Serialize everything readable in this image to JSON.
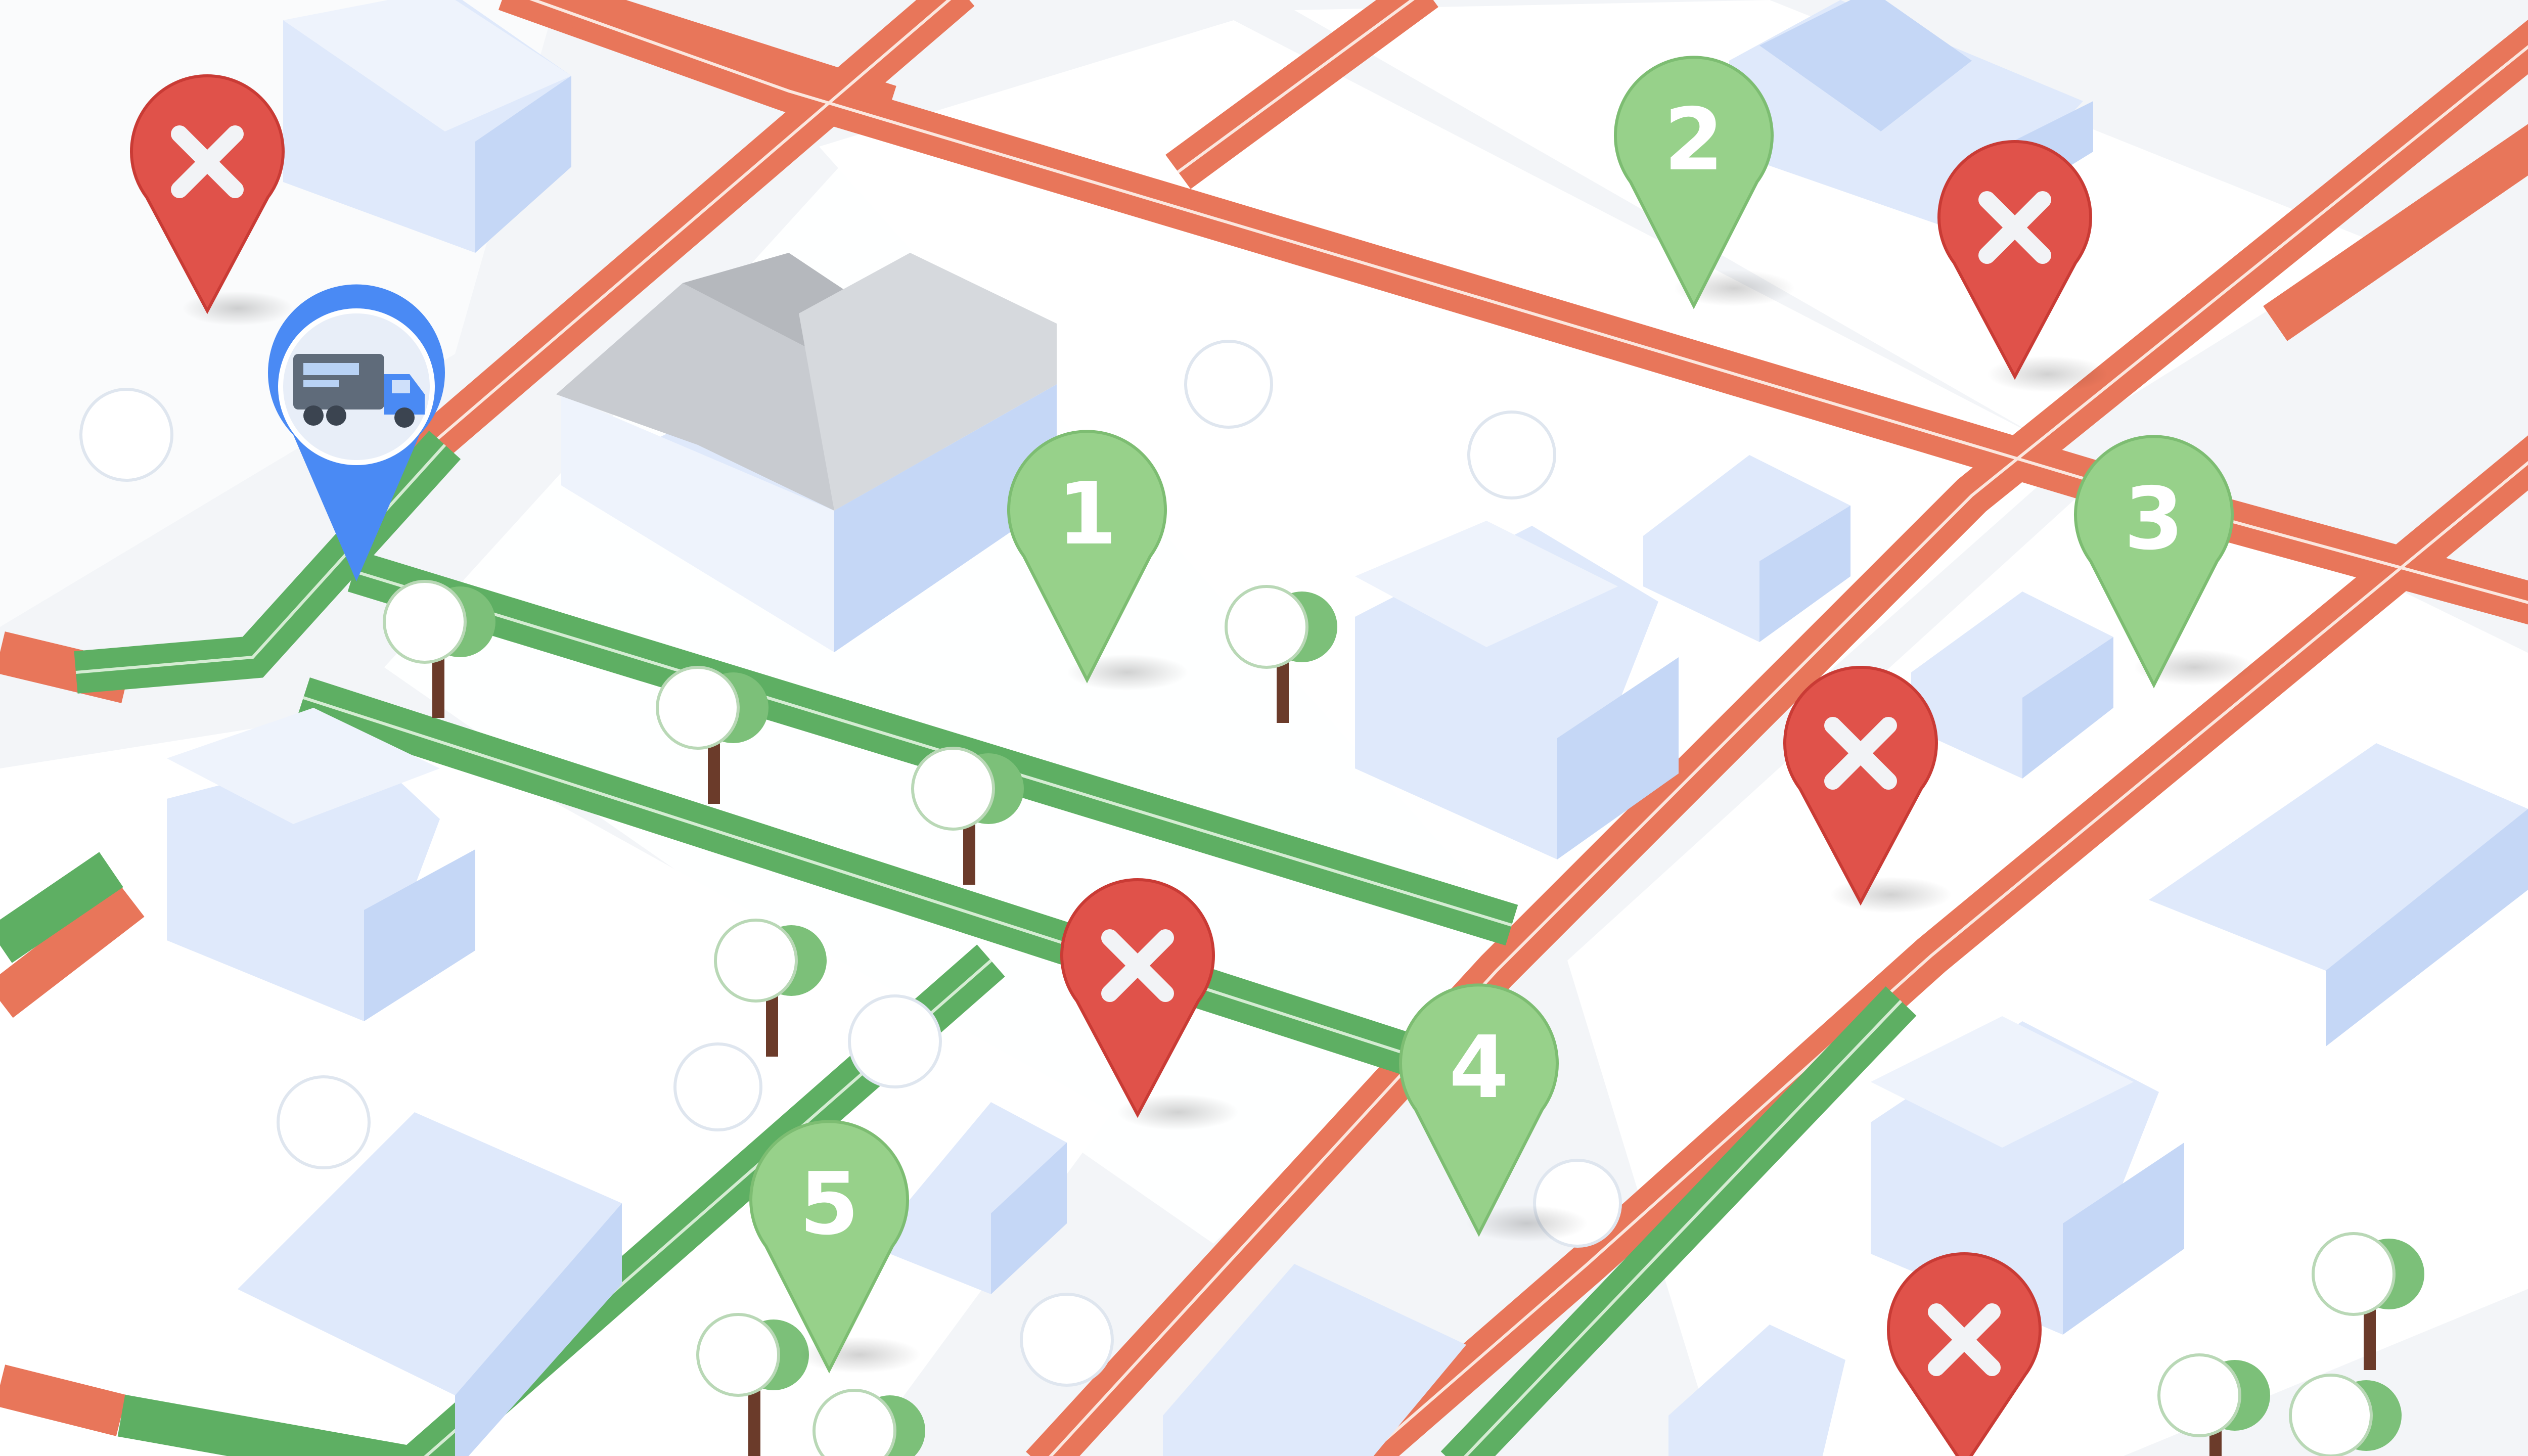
{
  "map": {
    "colors": {
      "ground": "#f3f5f8",
      "block": "#ffffff",
      "road_congested": "#e8765a",
      "road_clear": "#5eaf63",
      "road_line": "#fbe7df",
      "building_light": "#dfe9fb",
      "building_mid": "#c5d7f6",
      "building_dark": "#a9c1ec",
      "roof_gray": "#c8cbd0",
      "pin_green": "#97d18a",
      "pin_green_dark": "#7dbd72",
      "pin_red": "#e0524a",
      "pin_red_dark": "#c93b35",
      "pin_blue": "#4a8af4",
      "tree_green": "#7cc079",
      "trunk": "#6b3b2a"
    },
    "vehicle_marker": {
      "icon": "delivery-truck-icon"
    },
    "stops": [
      {
        "label": "1",
        "status": "ok"
      },
      {
        "label": "2",
        "status": "ok"
      },
      {
        "label": "3",
        "status": "ok"
      },
      {
        "label": "4",
        "status": "ok"
      },
      {
        "label": "5",
        "status": "ok"
      }
    ],
    "blocked": [
      {
        "icon": "close-icon",
        "status": "unavailable"
      },
      {
        "icon": "close-icon",
        "status": "unavailable"
      },
      {
        "icon": "close-icon",
        "status": "unavailable"
      },
      {
        "icon": "close-icon",
        "status": "unavailable"
      },
      {
        "icon": "close-icon",
        "status": "unavailable"
      }
    ]
  }
}
